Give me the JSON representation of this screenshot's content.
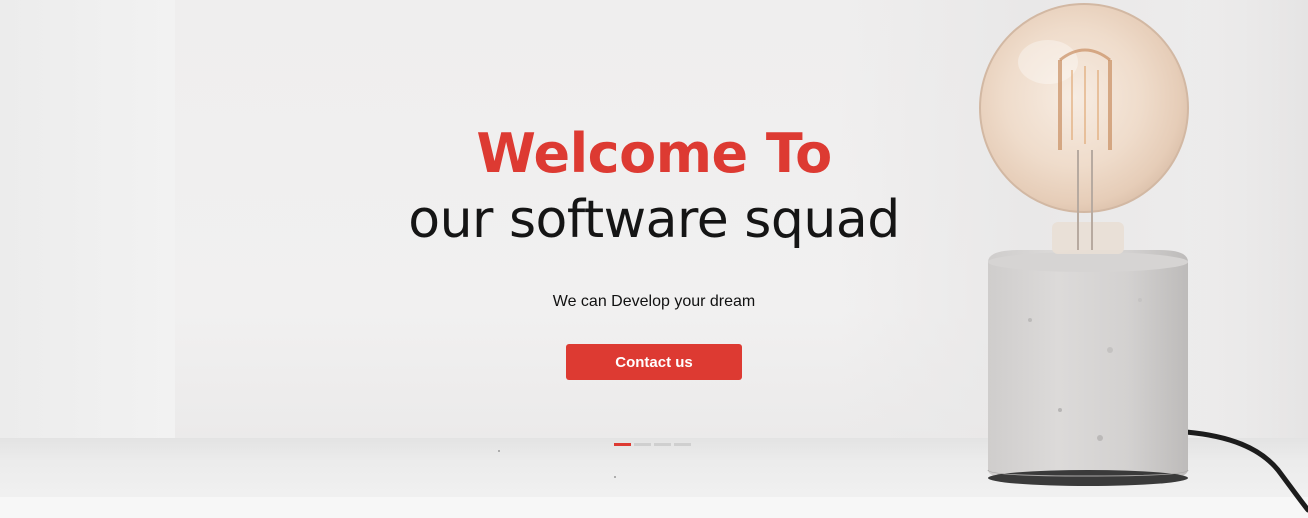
{
  "hero": {
    "title_accent": "Welcome To",
    "title_main": "our software squad",
    "tagline": "We can Develop your dream",
    "cta_label": "Contact us"
  },
  "carousel": {
    "slide_count": 4,
    "active_index": 0
  },
  "colors": {
    "accent": "#dd3a32",
    "text_dark": "#151515",
    "indicator_inactive": "#cfcfcf",
    "background": "#efeeee"
  },
  "images": {
    "hero_background": "lightbulb-lamp-on-shelf"
  }
}
